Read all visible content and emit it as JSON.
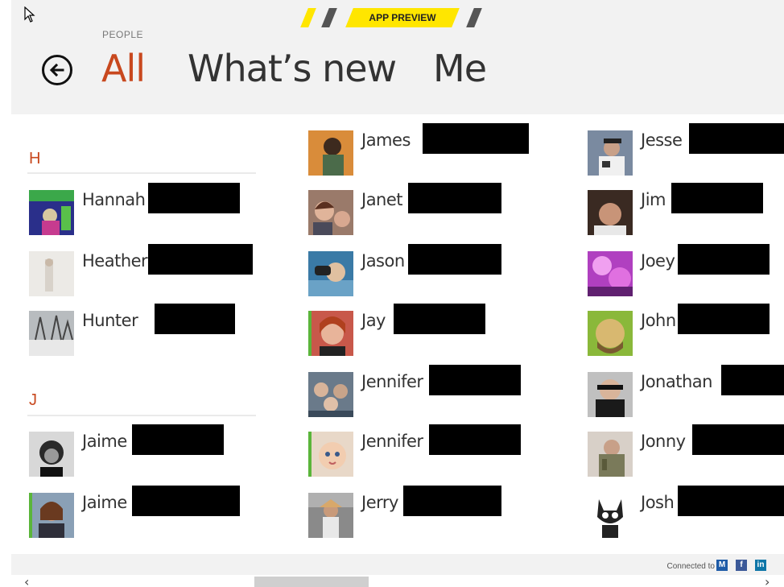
{
  "header": {
    "preview_badge": "APP PREVIEW",
    "section_label": "PEOPLE",
    "pivots": [
      {
        "label": "All",
        "active": true
      },
      {
        "label": "What’s new",
        "active": false
      },
      {
        "label": "Me",
        "active": false
      }
    ]
  },
  "groups": [
    {
      "letter": "H"
    },
    {
      "letter": "J"
    }
  ],
  "contacts": [
    {
      "name": "Hannah"
    },
    {
      "name": "Heather"
    },
    {
      "name": "Hunter"
    },
    {
      "name": "Jaime"
    },
    {
      "name": "Jaime"
    },
    {
      "name": "James"
    },
    {
      "name": "Janet"
    },
    {
      "name": "Jason"
    },
    {
      "name": "Jay"
    },
    {
      "name": "Jennifer"
    },
    {
      "name": "Jennifer"
    },
    {
      "name": "Jerry"
    },
    {
      "name": "Jesse"
    },
    {
      "name": "Jim"
    },
    {
      "name": "Joey"
    },
    {
      "name": "John"
    },
    {
      "name": "Jonathan"
    },
    {
      "name": "Jonny"
    },
    {
      "name": "Josh"
    }
  ],
  "footer": {
    "connected_label": "Connected to",
    "services": [
      {
        "name": "messenger",
        "glyph": "M",
        "color": "#1f5ca8"
      },
      {
        "name": "facebook",
        "glyph": "f",
        "color": "#3b5998"
      },
      {
        "name": "linkedin",
        "glyph": "in",
        "color": "#0e76a8"
      }
    ]
  },
  "scrollbar": {
    "left_arrow": "‹",
    "right_arrow": "›"
  },
  "colors": {
    "accent": "#c8481e",
    "preview_yellow": "#ffe600",
    "header_bg": "#f2f2f2"
  }
}
